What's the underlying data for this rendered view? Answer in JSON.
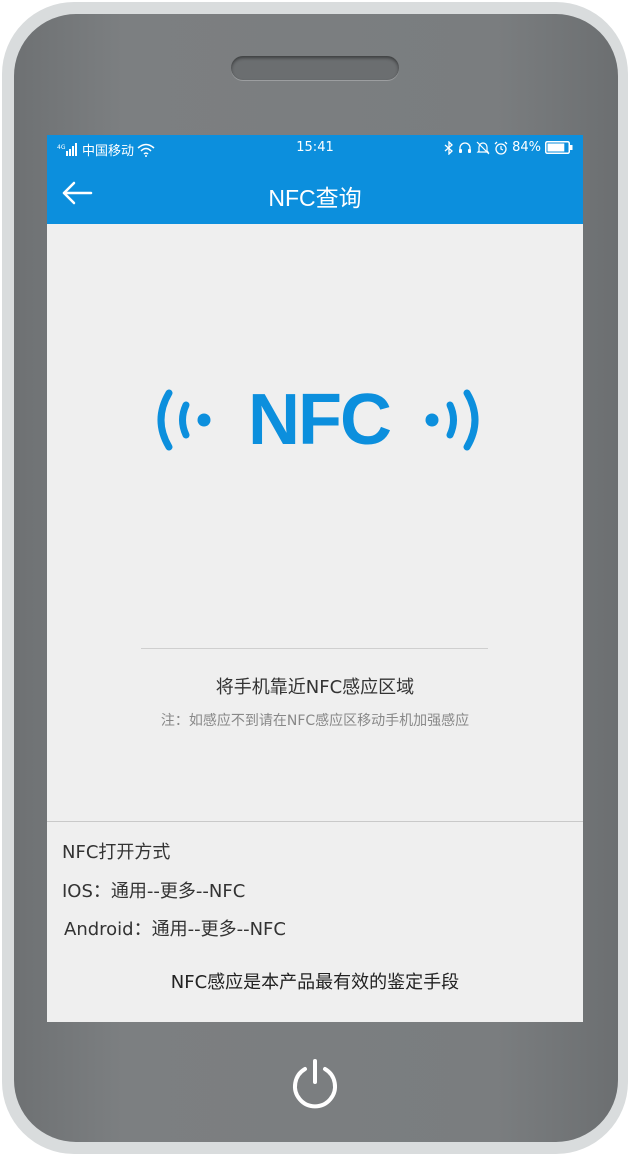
{
  "status_bar": {
    "signal": "4G",
    "carrier": "中国移动",
    "time": "15:41",
    "battery": "84%",
    "battery_level": 0.84
  },
  "header": {
    "title": "NFC查询"
  },
  "main": {
    "logo_text": "NFC",
    "instruction": "将手机靠近NFC感应区域",
    "note": "注：如感应不到请在NFC感应区移动手机加强感应"
  },
  "info": {
    "title": "NFC打开方式",
    "ios": "IOS：通用--更多--NFC",
    "android": "Android：通用--更多--NFC",
    "footer": "NFC感应是本产品最有效的鉴定手段"
  },
  "colors": {
    "accent": "#0c8fdd",
    "screen_bg": "#efefef",
    "phone_body": "#7a7d7f"
  },
  "icons": [
    "signal-icon",
    "wifi-icon",
    "bluetooth-icon",
    "headset-icon",
    "mute-icon",
    "alarm-icon",
    "battery-icon",
    "back-arrow-icon",
    "nfc-wave-icon",
    "power-icon"
  ]
}
